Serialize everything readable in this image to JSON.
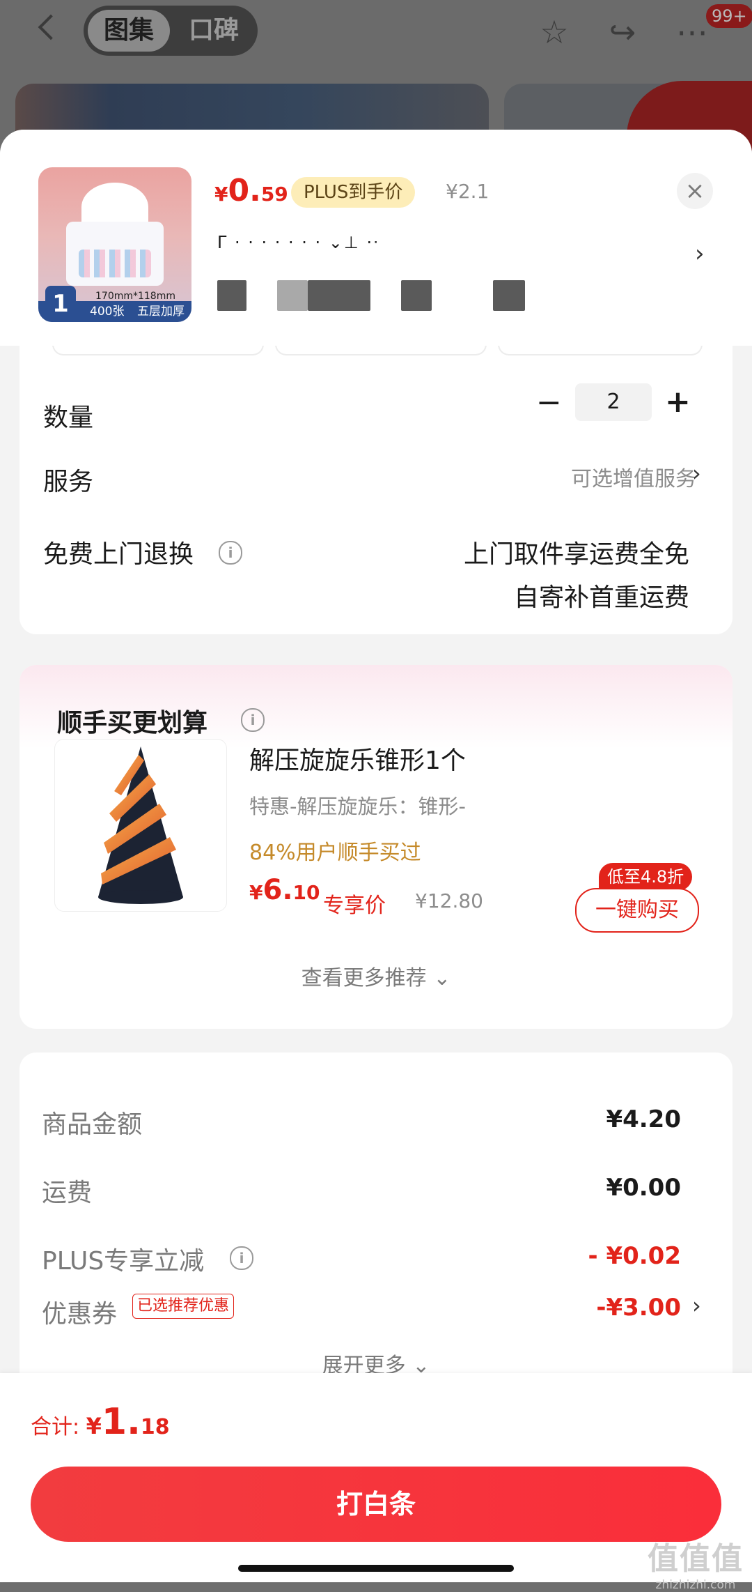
{
  "background_page": {
    "tabs": [
      "图集",
      "口碑"
    ],
    "notification_badge": "99+"
  },
  "product": {
    "price_yen": "¥",
    "price_int": "0.",
    "price_dec": "59",
    "plus_tag": "PLUS到手价",
    "original_price": "¥2.1",
    "close": "×",
    "image": {
      "size_text": "170mm*118mm",
      "count": "1",
      "sheets": "400张",
      "layers": "五层加厚"
    },
    "arrow": "›"
  },
  "quantity": {
    "label": "数量",
    "minus": "−",
    "value": "2",
    "plus": "+"
  },
  "service": {
    "label": "服务",
    "hint": "可选增值服务",
    "arrow": "›"
  },
  "free_return": {
    "label": "免费上门退换",
    "info": "i",
    "line1": "上门取件享运费全免",
    "line2": "自寄补首重运费"
  },
  "upsell": {
    "title": "顺手买更划算",
    "info": "i",
    "name": "解压旋旋乐锥形1个",
    "desc": "特惠-解压旋旋乐：锥形-",
    "buyers": "84%用户顺手买过",
    "price_yen": "¥",
    "price_int": "6.",
    "price_dec": "10",
    "exclusive": "专享价",
    "original_price": "¥12.80",
    "discount_tag": "低至4.8折",
    "buy_button": "一键购买",
    "more": "查看更多推荐 ⌄"
  },
  "summary": {
    "rows": [
      {
        "label": "商品金额",
        "value": "¥4.20"
      },
      {
        "label": "运费",
        "value": "¥0.00"
      },
      {
        "label": "PLUS专享立减",
        "value": "- ¥0.02"
      },
      {
        "label": "优惠券",
        "value": "-¥3.00"
      }
    ],
    "coupon_tag": "已选推荐优惠",
    "info": "i",
    "arrow": "›",
    "expand": "展开更多 ⌄"
  },
  "footer": {
    "total_label": "合计: ",
    "total_yen": "¥",
    "total_int": "1.",
    "total_dec": "18",
    "pay_button": "打白条"
  },
  "watermark": {
    "mark": "值值值",
    "url": "zhizhizhi.com"
  },
  "colors": {
    "accent_red": "#e2231a",
    "plus_gold": "#fdedb8",
    "buyers_orange": "#c58a2a"
  }
}
